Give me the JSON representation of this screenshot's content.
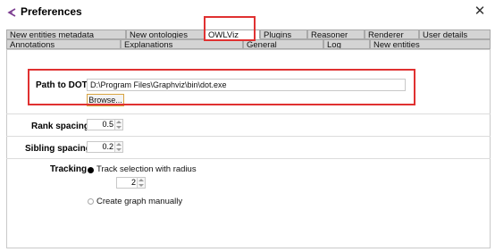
{
  "window": {
    "title": "Preferences",
    "app_icon": "protege-icon",
    "close_icon": "close-icon"
  },
  "tabs": {
    "row1": [
      "New entities metadata",
      "New ontologies",
      "OWLViz",
      "Plugins",
      "Reasoner",
      "Renderer",
      "User details"
    ],
    "row2": [
      "Annotations",
      "Explanations",
      "General",
      "Log",
      "New entities"
    ],
    "active": "OWLViz"
  },
  "path": {
    "label": "Path to DOT",
    "value": "D:\\Program Files\\Graphviz\\bin\\dot.exe",
    "browse_label": "Browse..."
  },
  "rank_spacing": {
    "label": "Rank spacing",
    "value": "0.5"
  },
  "sibling_spacing": {
    "label": "Sibling spacing",
    "value": "0.2"
  },
  "tracking": {
    "label": "Tracking",
    "option_radius": "Track selection with radius",
    "radius_value": "2",
    "option_manual": "Create graph manually",
    "selected": "option_radius"
  },
  "colors": {
    "highlight": "#e03131",
    "tab_bg": "#d4d4d4",
    "browse_border": "#d9a441"
  }
}
